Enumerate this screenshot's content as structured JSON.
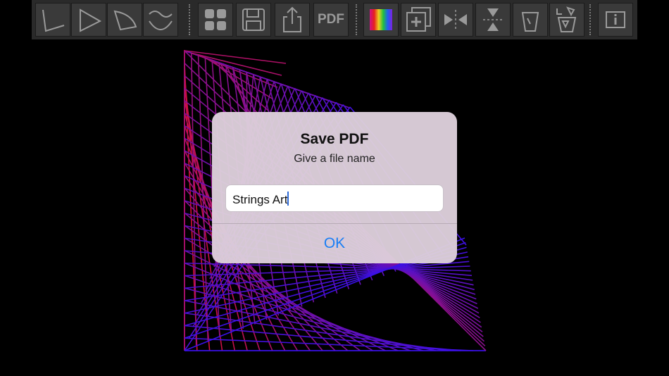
{
  "toolbar": {
    "buttons": [
      {
        "name": "angle-shape-button",
        "icon": "angle-shape-icon"
      },
      {
        "name": "triangle-shape-button",
        "icon": "triangle-shape-icon"
      },
      {
        "name": "sector-shape-button",
        "icon": "sector-shape-icon"
      },
      {
        "name": "curve-shape-button",
        "icon": "curve-shape-icon"
      },
      {
        "name": "gallery-button",
        "icon": "grid-icon"
      },
      {
        "name": "save-button",
        "icon": "floppy-disk-icon"
      },
      {
        "name": "share-button",
        "icon": "share-icon"
      },
      {
        "name": "pdf-button",
        "icon": "pdf-icon",
        "label": "PDF"
      },
      {
        "name": "color-palette-button",
        "icon": "color-spectrum-icon"
      },
      {
        "name": "add-layer-button",
        "icon": "add-layer-icon"
      },
      {
        "name": "mirror-horizontal-button",
        "icon": "mirror-horizontal-icon"
      },
      {
        "name": "mirror-vertical-button",
        "icon": "mirror-vertical-icon"
      },
      {
        "name": "clear-button",
        "icon": "trash-empty-icon"
      },
      {
        "name": "clear-all-button",
        "icon": "trash-full-icon"
      },
      {
        "name": "info-button",
        "icon": "info-icon"
      }
    ],
    "pdf_label": "PDF"
  },
  "canvas": {
    "colors": {
      "start": "#e0102e",
      "end": "#3a10e8"
    }
  },
  "dialog": {
    "title": "Save PDF",
    "message": "Give a file name",
    "input_value": "Strings Art",
    "ok_label": "OK"
  },
  "colors": {
    "accent": "#1a7ef5",
    "toolbar_bg": "#2a2a2a",
    "button_bg": "#3a3a3a",
    "icon": "#9a9a9a"
  }
}
